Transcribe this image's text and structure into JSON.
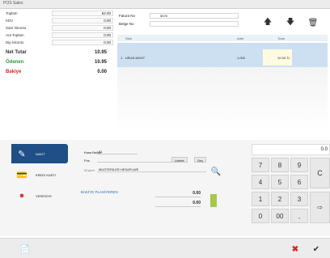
{
  "window": {
    "title": "POS Sales"
  },
  "totals": {
    "rows": [
      {
        "label": "Toplam",
        "value": "62.00"
      },
      {
        "label": "KDV",
        "value": "0.00"
      },
      {
        "label": "Satır İskonto",
        "value": "0.00"
      },
      {
        "label": "Ara Toplam",
        "value": "0.00"
      },
      {
        "label": "Dip İskonto",
        "value": "0.00"
      }
    ],
    "net_total": {
      "label": "Net Tutar",
      "value": "10.95"
    },
    "received": {
      "label": "Ödenen",
      "value": "10.95"
    },
    "change": {
      "label": "Bakiye",
      "value": "0.00"
    },
    "colors": {
      "received": "#2c9a3c",
      "change": "#d8262a"
    }
  },
  "header": {
    "receipt_no_label": "Fatura No",
    "receipt_no_value": "5678",
    "note_label": "Belge No"
  },
  "table": {
    "columns": [
      "Stok",
      "Adet",
      "Tutar"
    ],
    "rows": [
      {
        "name": "1 · URUN MOHT",
        "qty": "1.000",
        "amount": "10.95 TL"
      }
    ]
  },
  "tabs": [
    {
      "label": "NAKİT",
      "icon": "cash-icon"
    },
    {
      "label": "KREDİ KARTI",
      "icon": "credit-card-icon"
    },
    {
      "label": "VERESİYE",
      "icon": "person-icon"
    }
  ],
  "payment": {
    "kasa_label": "Kasa Belirle",
    "kasa_value": "01",
    "bank_label": "Pos",
    "btn_list": "Listele",
    "btn_select": "Seç",
    "card_label": "Müşteri",
    "card_value": "MUSTERILER HESAPLARI",
    "amount_label": "BAKİYE PLASİYEREN",
    "amount1": "0.00",
    "amount2": "0.00"
  },
  "keypad": {
    "display": "0.0",
    "keys": [
      "7",
      "8",
      "9",
      "4",
      "5",
      "6",
      "1",
      "2",
      "3",
      "0",
      "00",
      ","
    ],
    "clear_label": "C"
  },
  "icons": {
    "up": "up-arrow-icon",
    "down": "down-arrow-icon",
    "trash": "trash-icon",
    "search": "search-icon",
    "enter": "enter-icon",
    "cancel": "cancel-icon",
    "ok": "ok-icon",
    "doc": "document-icon"
  }
}
